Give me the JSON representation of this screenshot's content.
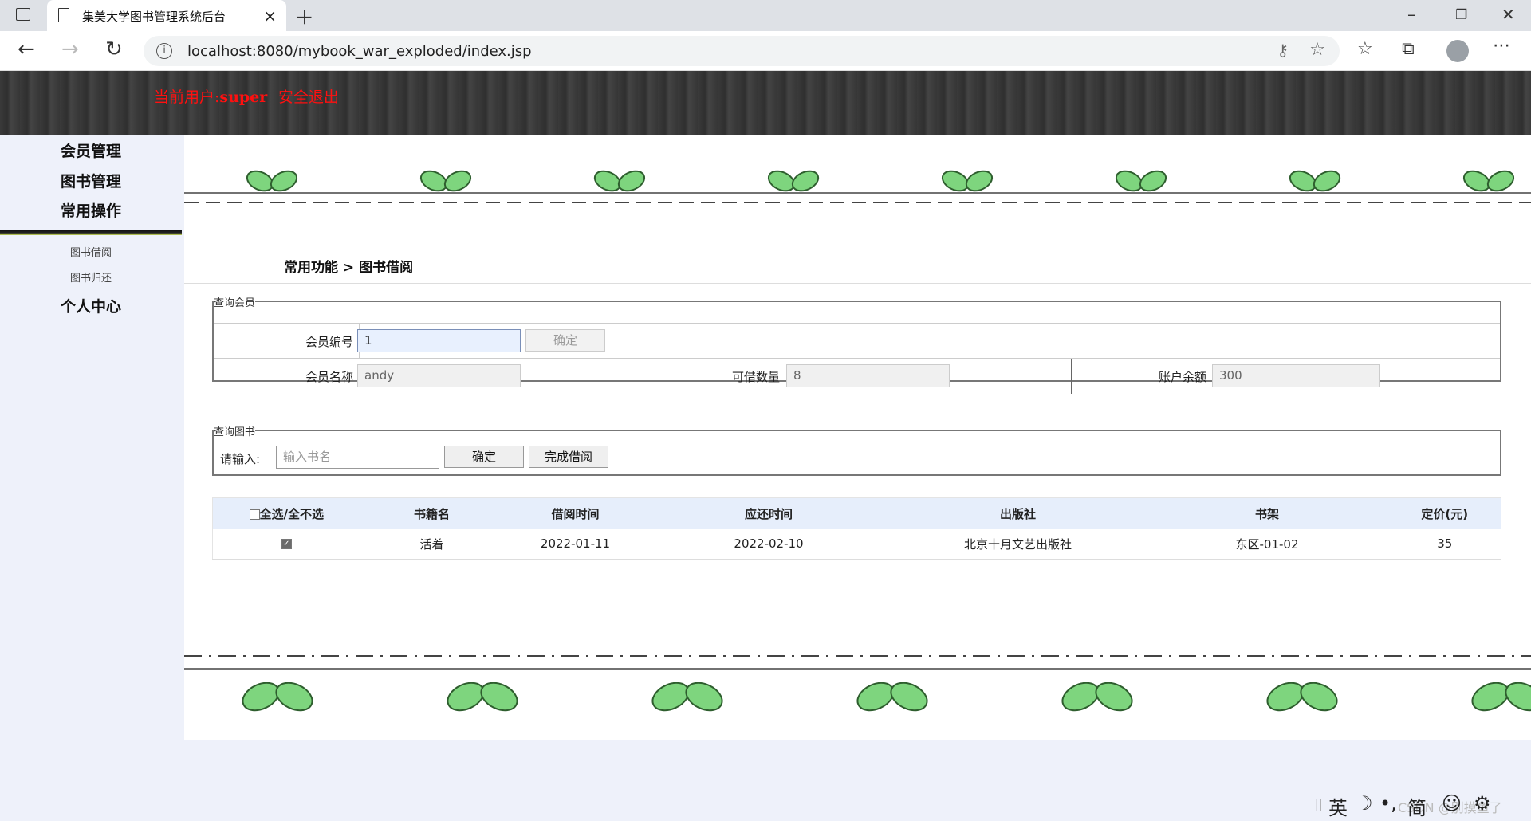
{
  "browser": {
    "tab_title": "集美大学图书管理系统后台",
    "url": "localhost:8080/mybook_war_exploded/index.jsp"
  },
  "header": {
    "user_prefix": "当前用户:",
    "username": "super",
    "logout_label": "安全退出"
  },
  "sidebar": {
    "menus": [
      "会员管理",
      "图书管理",
      "常用操作"
    ],
    "submenu": [
      "图书借阅",
      "图书归还"
    ],
    "personal": "个人中心"
  },
  "breadcrumb": "常用功能 > 图书借阅",
  "member_query": {
    "legend": "查询会员",
    "id_label": "会员编号",
    "id_value": "1",
    "confirm_label": "确定",
    "name_label": "会员名称",
    "name_value": "andy",
    "borrowable_label": "可借数量",
    "borrowable_value": "8",
    "balance_label": "账户余额",
    "balance_value": "300"
  },
  "book_query": {
    "legend": "查询图书",
    "input_label": "请输入:",
    "placeholder": "输入书名",
    "confirm_label": "确定",
    "finish_label": "完成借阅"
  },
  "table": {
    "headers": [
      "全选/全不选",
      "书籍名",
      "借阅时间",
      "应还时间",
      "出版社",
      "书架",
      "定价(元)"
    ],
    "rows": [
      {
        "checked": true,
        "name": "活着",
        "borrow_date": "2022-01-11",
        "due_date": "2022-02-10",
        "publisher": "北京十月文艺出版社",
        "shelf": "东区-01-02",
        "price": "35"
      }
    ]
  },
  "ime": {
    "lang": "英",
    "mode": "简",
    "watermark": "CSDN @别摸鱼了"
  },
  "colors": {
    "header_text": "#ff1010",
    "leaf_green": "#7ed57e",
    "table_header": "#e6eefb"
  }
}
